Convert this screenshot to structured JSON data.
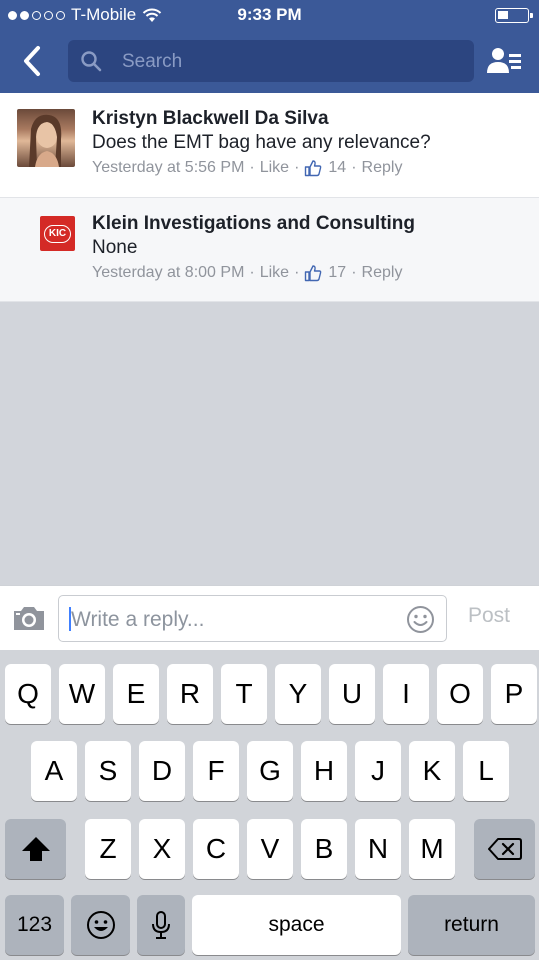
{
  "status_bar": {
    "carrier": "T-Mobile",
    "time": "9:33 PM"
  },
  "header": {
    "search_placeholder": "Search"
  },
  "comments": [
    {
      "author": "Kristyn Blackwell Da Silva",
      "text": "Does the EMT bag have any relevance?",
      "timestamp": "Yesterday at 5:56 PM",
      "like_label": "Like",
      "like_count": "14",
      "reply_label": "Reply"
    },
    {
      "author": "Klein Investigations and Consulting",
      "logo_text": "KIC",
      "text": "None",
      "timestamp": "Yesterday at 8:00 PM",
      "like_label": "Like",
      "like_count": "17",
      "reply_label": "Reply"
    }
  ],
  "composer": {
    "placeholder": "Write a reply...",
    "post_label": "Post"
  },
  "keyboard": {
    "row1": [
      "Q",
      "W",
      "E",
      "R",
      "T",
      "Y",
      "U",
      "I",
      "O",
      "P"
    ],
    "row2": [
      "A",
      "S",
      "D",
      "F",
      "G",
      "H",
      "J",
      "K",
      "L"
    ],
    "row3": [
      "Z",
      "X",
      "C",
      "V",
      "B",
      "N",
      "M"
    ],
    "numbers_label": "123",
    "space_label": "space",
    "return_label": "return"
  },
  "colors": {
    "brand": "#3b5998",
    "like_blue": "#4267b2"
  }
}
